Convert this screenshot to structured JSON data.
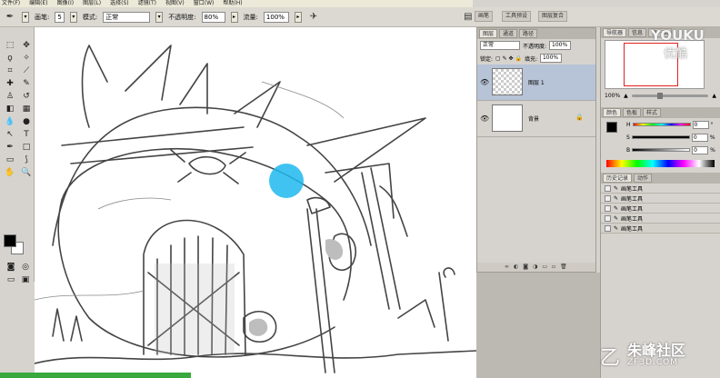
{
  "menu": [
    "文件(F)",
    "编辑(E)",
    "图像(I)",
    "图层(L)",
    "选择(S)",
    "滤镜(T)",
    "视图(V)",
    "窗口(W)",
    "帮助(H)"
  ],
  "options": {
    "brush_label": "画笔:",
    "brush_size": "5",
    "mode_label": "模式:",
    "mode_value": "正常",
    "opacity_label": "不透明度:",
    "opacity_value": "80%",
    "flow_label": "流量:",
    "flow_value": "100%"
  },
  "window_tabs": [
    "画笔",
    "工具预设",
    "图层复合"
  ],
  "layers_panel": {
    "tabs": [
      "图层",
      "通道",
      "路径"
    ],
    "blend_mode": "正常",
    "opacity_label": "不透明度:",
    "opacity_value": "100%",
    "lock_label": "锁定:",
    "fill_label": "填充:",
    "fill_value": "100%",
    "layers": [
      {
        "name": "图层 1",
        "selected": true
      },
      {
        "name": "背景",
        "selected": false
      }
    ]
  },
  "navigator": {
    "tabs": [
      "导航器",
      "信息",
      "直方图"
    ],
    "zoom": "100%"
  },
  "color_panel": {
    "tabs": [
      "颜色",
      "色板",
      "样式"
    ],
    "channels": [
      {
        "label": "H",
        "value": "0"
      },
      {
        "label": "S",
        "value": "0"
      },
      {
        "label": "B",
        "value": "0"
      }
    ],
    "units": [
      "°",
      "%",
      "%"
    ]
  },
  "history_panel": {
    "tabs": [
      "历史记录",
      "动作"
    ],
    "items": [
      "画笔工具",
      "画笔工具",
      "画笔工具",
      "画笔工具",
      "画笔工具"
    ]
  },
  "watermarks": {
    "youku": "YOUKU",
    "youku_sub": "优酷",
    "site": "朱峰社区",
    "site_url": "ZF3D.COM"
  },
  "colors": {
    "cursor": "#1fb8ef",
    "layer_selected": "#b7c3d6"
  }
}
